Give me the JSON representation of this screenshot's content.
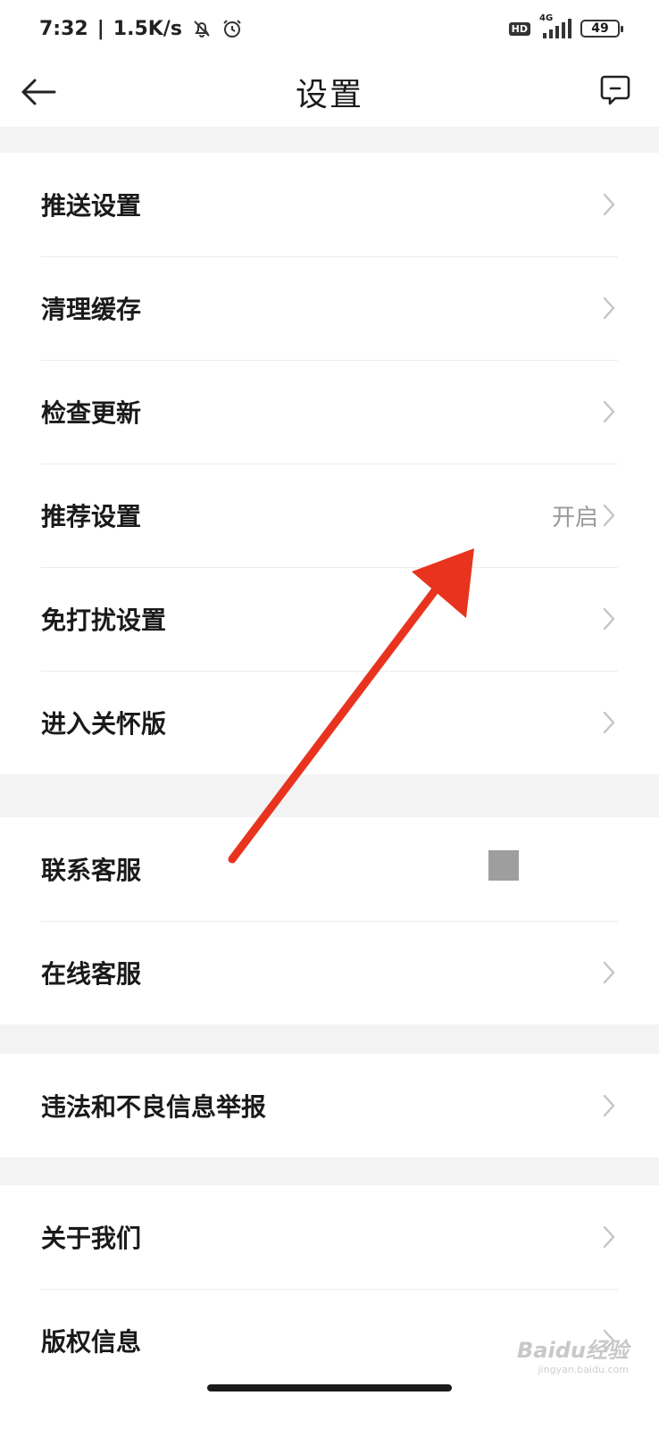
{
  "status_bar": {
    "time": "7:32",
    "speed": "1.5K/s",
    "hd": "HD",
    "network": "4G",
    "battery": "49"
  },
  "header": {
    "title": "设置",
    "back_icon": "arrow-left-icon",
    "message_icon": "message-square-icon"
  },
  "groups": [
    {
      "items": [
        {
          "label": "推送设置"
        },
        {
          "label": "清理缓存"
        },
        {
          "label": "检查更新"
        },
        {
          "label": "推荐设置",
          "value": "开启"
        },
        {
          "label": "免打扰设置"
        },
        {
          "label": "进入关怀版"
        }
      ]
    },
    {
      "items": [
        {
          "label": "联系客服"
        },
        {
          "label": "在线客服"
        }
      ]
    },
    {
      "items": [
        {
          "label": "违法和不良信息举报"
        }
      ]
    },
    {
      "items": [
        {
          "label": "关于我们"
        },
        {
          "label": "版权信息"
        }
      ]
    }
  ],
  "annotation": {
    "arrow_color": "#e8341f"
  },
  "watermark": {
    "brand": "Baidu经验",
    "url": "jingyan.baidu.com"
  }
}
